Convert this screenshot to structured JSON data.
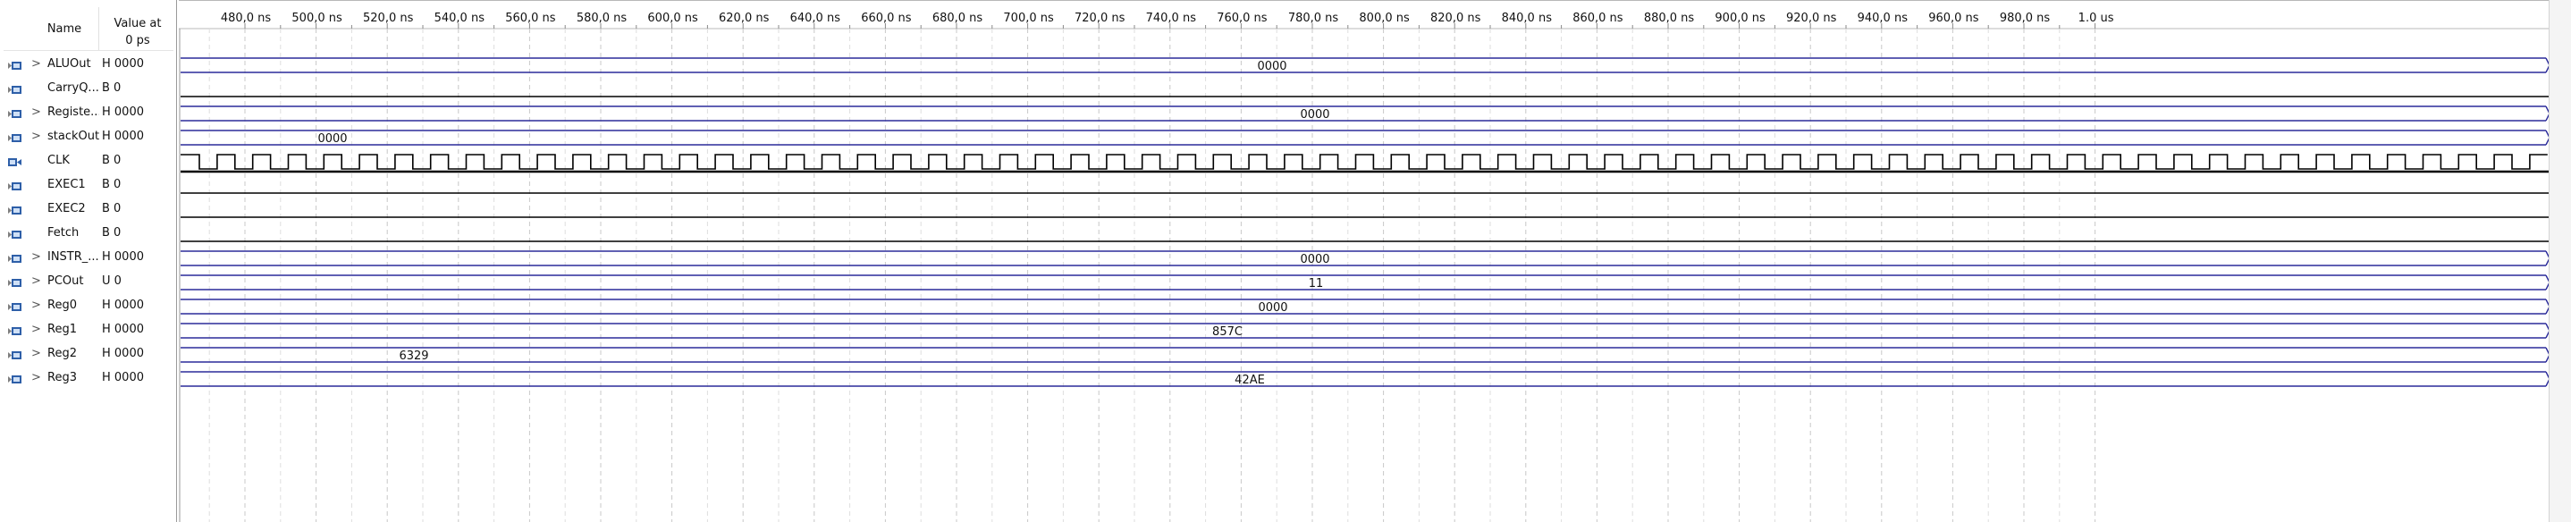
{
  "header": {
    "name_label": "Name",
    "value_label_1": "Value at",
    "value_label_2": "0 ps"
  },
  "timeline": {
    "ticks": [
      "480,0 ns",
      "500,0 ns",
      "520,0 ns",
      "540,0 ns",
      "560,0 ns",
      "580,0 ns",
      "600,0 ns",
      "620,0 ns",
      "640,0 ns",
      "660,0 ns",
      "680,0 ns",
      "700,0 ns",
      "720,0 ns",
      "740,0 ns",
      "760,0 ns",
      "780,0 ns",
      "800,0 ns",
      "820,0 ns",
      "840,0 ns",
      "860,0 ns",
      "880,0 ns",
      "900,0 ns",
      "920,0 ns",
      "940,0 ns",
      "960,0 ns",
      "980,0 ns",
      "1.0 us"
    ]
  },
  "signals": [
    {
      "name": "ALUOut",
      "value": "H 0000",
      "kind": "bus",
      "expand": ">",
      "label": "0000",
      "icon": "output-pin-icon"
    },
    {
      "name": "CarryQ...",
      "value": "B 0",
      "kind": "low",
      "expand": "",
      "label": "",
      "icon": "output-pin-icon"
    },
    {
      "name": "Registe...",
      "value": "H 0000",
      "kind": "bus",
      "expand": ">",
      "label": "0000",
      "icon": "output-pin-icon"
    },
    {
      "name": "stackOut",
      "value": "H 0000",
      "kind": "bus",
      "expand": ">",
      "label": "0000",
      "icon": "output-pin-icon"
    },
    {
      "name": "CLK",
      "value": "B 0",
      "kind": "clock",
      "expand": "",
      "label": "",
      "icon": "input-pin-icon"
    },
    {
      "name": "EXEC1",
      "value": "B 0",
      "kind": "low",
      "expand": "",
      "label": "",
      "icon": "output-pin-icon"
    },
    {
      "name": "EXEC2",
      "value": "B 0",
      "kind": "low",
      "expand": "",
      "label": "",
      "icon": "output-pin-icon"
    },
    {
      "name": "Fetch",
      "value": "B 0",
      "kind": "low",
      "expand": "",
      "label": "",
      "icon": "output-pin-icon"
    },
    {
      "name": "INSTR_...",
      "value": "H 0000",
      "kind": "bus",
      "expand": ">",
      "label": "0000",
      "icon": "output-pin-icon"
    },
    {
      "name": "PCOut",
      "value": "U 0",
      "kind": "bus",
      "expand": ">",
      "label": "11",
      "icon": "output-pin-icon"
    },
    {
      "name": "Reg0",
      "value": "H 0000",
      "kind": "bus",
      "expand": ">",
      "label": "0000",
      "icon": "output-pin-icon"
    },
    {
      "name": "Reg1",
      "value": "H 0000",
      "kind": "bus",
      "expand": ">",
      "label": "857C",
      "icon": "output-pin-icon"
    },
    {
      "name": "Reg2",
      "value": "H 0000",
      "kind": "bus",
      "expand": ">",
      "label": "6329",
      "icon": "output-pin-icon"
    },
    {
      "name": "Reg3",
      "value": "H 0000",
      "kind": "bus",
      "expand": ">",
      "label": "42AE",
      "icon": "output-pin-icon"
    }
  ],
  "colors": {
    "bus_line": "#2c2c9a",
    "signal_line": "#000000",
    "grid_line": "#c8c8c8",
    "icon_blue": "#2e5fa8"
  }
}
